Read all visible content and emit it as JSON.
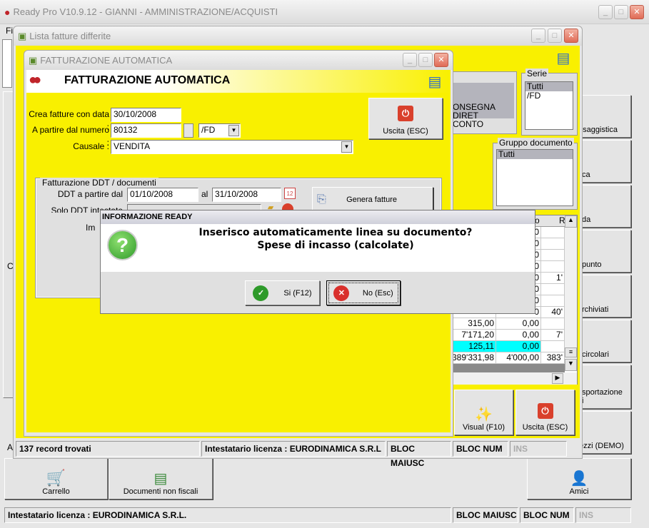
{
  "main_window": {
    "title": "Ready Pro V10.9.12 - GIANNI - AMMINISTRAZIONE/ACQUISTI",
    "menu_partial": "Fi",
    "side_buttons": [
      "ssaggistica",
      "ca",
      "da",
      "punto",
      "rchiviati",
      "circolari",
      "sportazione\ni",
      "ezzi (DEMO)"
    ],
    "side_left_partial": [
      "C",
      "A"
    ],
    "toolbar": [
      {
        "label": "Carrello",
        "icon": "cart-icon"
      },
      {
        "label": "Documenti non fiscali",
        "icon": "documents-people-icon"
      },
      {
        "label": "Amici",
        "icon": "person-icon"
      }
    ],
    "status": {
      "license": "Intestatario licenza : EURODINAMICA S.R.L.",
      "caps": "BLOC MAIUSC",
      "num": "BLOC NUM",
      "ins": "INS"
    }
  },
  "lista_window": {
    "title": "Lista fatture differite",
    "list_items": [
      "ONSEGNA DIRET",
      "CONTO"
    ],
    "serie": {
      "label": "Serie",
      "items": [
        "Tutti",
        "/FD"
      ],
      "selected": "Tutti"
    },
    "gruppo": {
      "label": "Gruppo documento",
      "items": [
        "Tutti"
      ],
      "selected": "Tutti"
    },
    "grid": {
      "headers": [
        "o",
        "R"
      ],
      "rows": [
        [
          "",
          "0",
          ""
        ],
        [
          "",
          "0",
          ""
        ],
        [
          "",
          "0",
          ""
        ],
        [
          "",
          "0",
          ""
        ],
        [
          "",
          "0",
          "1'"
        ],
        [
          "",
          "0",
          ""
        ],
        [
          "",
          "0",
          ""
        ],
        [
          "",
          "0",
          "40'"
        ],
        [
          "315,00",
          "0,00",
          ""
        ],
        [
          "7'171,20",
          "0,00",
          "7'"
        ],
        [
          "125,11",
          "0,00",
          ""
        ],
        [
          "389'331,98",
          "4'000,00",
          "383'"
        ]
      ],
      "highlight_row": 10,
      "highlight_color": "#00ffff"
    },
    "visual_button": "Visual (F10)",
    "exit_button": "Uscita (ESC)",
    "status": {
      "records": "137 record trovati",
      "license": "Intestatario licenza : EURODINAMICA S.R.L",
      "caps": "BLOC MAIUSC",
      "num": "BLOC NUM",
      "ins": "INS"
    }
  },
  "fatt_window": {
    "title": "FATTURAZIONE AUTOMATICA",
    "header": "FATTURAZIONE AUTOMATICA",
    "data_label": "Crea fatture con data :",
    "data_value": "30/10/2008",
    "numero_label": "A partire dal numero :",
    "numero_value": "80132",
    "serie_value": "/FD",
    "causale_label": "Causale :",
    "causale_value": "VENDITA",
    "exit_button": "Uscita (ESC)",
    "group": {
      "title": "Fatturazione DDT / documenti",
      "ddt_label": "DDT a partire dal",
      "ddt_from": "01/10/2008",
      "al_label": "al",
      "ddt_to": "31/10/2008",
      "solo_label": "Solo DDT intestate a:",
      "im_label": "Im",
      "genera_button": "Genera fatture"
    }
  },
  "dialog": {
    "title": "INFORMAZIONE READY",
    "line1": "Inserisco automaticamente linea su documento?",
    "line2": "Spese di incasso (calcolate)",
    "yes": "Si (F12)",
    "no": "No (Esc)"
  },
  "colors": {
    "yellow": "#f9f000",
    "selection": "#b4b4bc",
    "cyan": "#00ffff"
  }
}
